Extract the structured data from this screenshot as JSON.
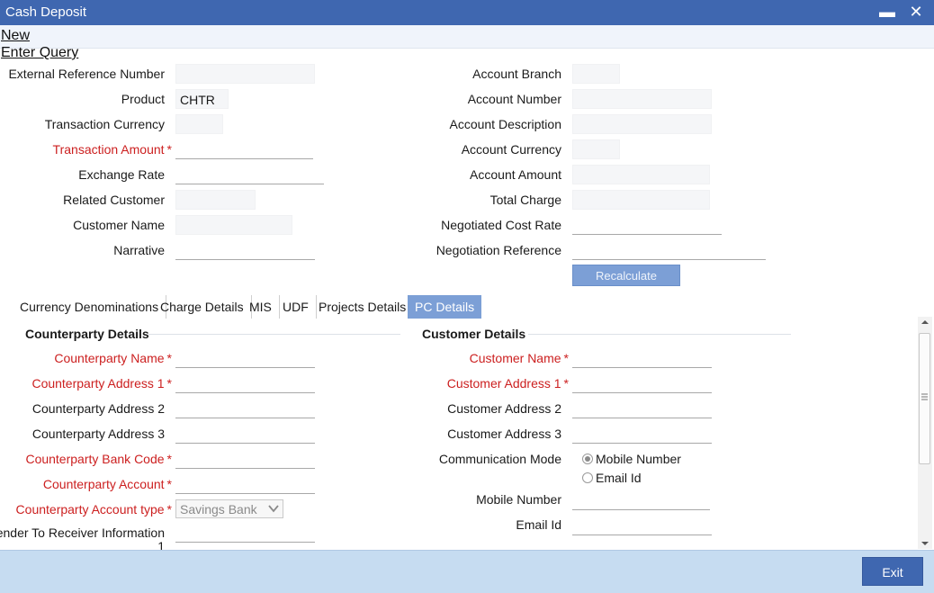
{
  "window": {
    "title": "Cash Deposit"
  },
  "menu": {
    "new": "New",
    "enter_query": "Enter Query"
  },
  "main": {
    "external_reference_number": {
      "label": "External Reference Number",
      "value": ""
    },
    "product": {
      "label": "Product",
      "value": "CHTR"
    },
    "transaction_currency": {
      "label": "Transaction Currency",
      "value": ""
    },
    "transaction_amount": {
      "label": "Transaction Amount",
      "value": ""
    },
    "exchange_rate": {
      "label": "Exchange Rate",
      "value": ""
    },
    "related_customer": {
      "label": "Related Customer",
      "value": ""
    },
    "customer_name": {
      "label": "Customer Name",
      "value": ""
    },
    "narrative": {
      "label": "Narrative",
      "value": ""
    },
    "account_branch": {
      "label": "Account Branch",
      "value": ""
    },
    "account_number": {
      "label": "Account Number",
      "value": ""
    },
    "account_description": {
      "label": "Account Description",
      "value": ""
    },
    "account_currency": {
      "label": "Account Currency",
      "value": ""
    },
    "account_amount": {
      "label": "Account Amount",
      "value": ""
    },
    "total_charge": {
      "label": "Total Charge",
      "value": ""
    },
    "negotiated_cost_rate": {
      "label": "Negotiated Cost Rate",
      "value": ""
    },
    "negotiation_reference": {
      "label": "Negotiation Reference",
      "value": ""
    },
    "recalculate_label": "Recalculate"
  },
  "required_mark": "*",
  "tabs": [
    {
      "label": "Currency Denominations"
    },
    {
      "label": "Charge Details"
    },
    {
      "label": "MIS"
    },
    {
      "label": "UDF"
    },
    {
      "label": "Projects Details"
    },
    {
      "label": "PC Details",
      "active": true
    }
  ],
  "counterparty": {
    "title": "Counterparty Details",
    "name": "Counterparty Name",
    "address1": "Counterparty Address 1",
    "address2": "Counterparty Address 2",
    "address3": "Counterparty Address 3",
    "bank_code": "Counterparty Bank Code",
    "account": "Counterparty Account",
    "account_type": "Counterparty Account type",
    "account_type_value": "Savings Bank",
    "sender_info_line1": "Sender To Receiver Information",
    "sender_info_line2": "1"
  },
  "customer": {
    "title": "Customer Details",
    "name": "Customer Name",
    "address1": "Customer Address 1",
    "address2": "Customer Address 2",
    "address3": "Customer Address 3",
    "communication_mode": "Communication Mode",
    "mode_mobile": "Mobile Number",
    "mode_email": "Email Id",
    "mode_selected": "Mobile Number",
    "mobile_number": "Mobile Number",
    "email_id": "Email Id"
  },
  "footer": {
    "exit_label": "Exit"
  },
  "colors": {
    "titlebar": "#3f67b0",
    "accent": "#7c9fd6",
    "required": "#cc1f1f",
    "footer": "#c6dcf1"
  }
}
